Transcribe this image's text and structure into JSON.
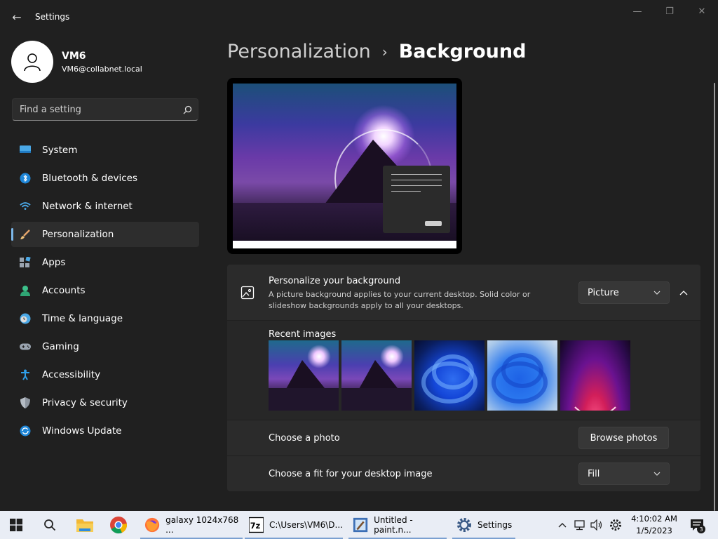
{
  "window": {
    "title": "Settings",
    "back_glyph": "←",
    "minimize_glyph": "—",
    "maximize_glyph": "❐",
    "close_glyph": "✕"
  },
  "user": {
    "name": "VM6",
    "email": "VM6@collabnet.local"
  },
  "search": {
    "placeholder": "Find a setting"
  },
  "nav": {
    "items": [
      {
        "label": "System",
        "icon": "monitor-icon"
      },
      {
        "label": "Bluetooth & devices",
        "icon": "bluetooth-icon"
      },
      {
        "label": "Network & internet",
        "icon": "wifi-icon"
      },
      {
        "label": "Personalization",
        "icon": "brush-icon",
        "active": true
      },
      {
        "label": "Apps",
        "icon": "apps-icon"
      },
      {
        "label": "Accounts",
        "icon": "person-icon"
      },
      {
        "label": "Time & language",
        "icon": "clock-globe-icon"
      },
      {
        "label": "Gaming",
        "icon": "gamepad-icon"
      },
      {
        "label": "Accessibility",
        "icon": "accessibility-icon"
      },
      {
        "label": "Privacy & security",
        "icon": "shield-icon"
      },
      {
        "label": "Windows Update",
        "icon": "update-icon"
      }
    ]
  },
  "breadcrumb": {
    "parent": "Personalization",
    "separator": "›",
    "current": "Background"
  },
  "personalize": {
    "title": "Personalize your background",
    "description": "A picture background applies to your current desktop. Solid color or slideshow backgrounds apply to all your desktops.",
    "selected": "Picture"
  },
  "recent": {
    "label": "Recent images",
    "images": [
      "galaxy-1",
      "galaxy-2",
      "bloom-dark",
      "bloom-light",
      "flow"
    ]
  },
  "photo": {
    "label": "Choose a photo",
    "button": "Browse photos"
  },
  "fit": {
    "label": "Choose a fit for your desktop image",
    "selected": "Fill"
  },
  "taskbar": {
    "apps": [
      {
        "label": "galaxy 1024x768 ...",
        "icon": "firefox-icon"
      },
      {
        "label": "C:\\Users\\VM6\\D...",
        "icon": "7zip-icon"
      },
      {
        "label": "Untitled - paint.n...",
        "icon": "paint-icon"
      },
      {
        "label": "Settings",
        "icon": "settings-gear-icon"
      }
    ],
    "tray_glyph": "^",
    "clock_time": "4:10:02 AM",
    "clock_date": "1/5/2023",
    "notification_count": "3"
  },
  "colors": {
    "accent": "#7cb8ea",
    "background": "#202020",
    "card": "#2b2b2b"
  }
}
